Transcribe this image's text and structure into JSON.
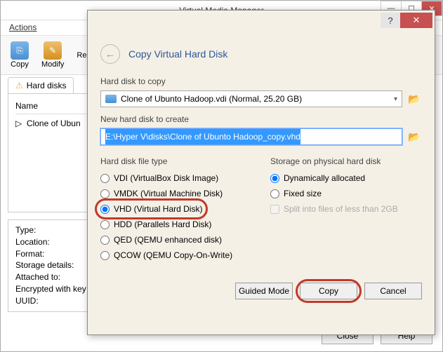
{
  "parent": {
    "title": "Virtual Media Manager",
    "menu": {
      "actions": "Actions"
    },
    "toolbar": {
      "copy": "Copy",
      "modify": "Modify",
      "remove": "Rem"
    },
    "tab": {
      "harddisks": "Hard disks"
    },
    "list": {
      "header": "Name",
      "item": "Clone of Ubun"
    },
    "details": {
      "type": "Type:",
      "location": "Location:",
      "format": "Format:",
      "storage": "Storage details:",
      "attached": "Attached to:",
      "encrypted": "Encrypted with key",
      "uuid": "UUID:"
    },
    "buttons": {
      "close": "Close",
      "help": "Help"
    }
  },
  "wizard": {
    "title": "Copy Virtual Hard Disk",
    "section_copy": "Hard disk to copy",
    "dropdown_value": "Clone of Ubunto Hadoop.vdi (Normal, 25.20 GB)",
    "section_new": "New hard disk to create",
    "path_value": "E:\\Hyper V\\disks\\Clone of Ubunto Hadoop_copy.vhd",
    "section_filetype": "Hard disk file type",
    "section_storage": "Storage on physical hard disk",
    "filetypes": {
      "vdi": "VDI (VirtualBox Disk Image)",
      "vmdk": "VMDK (Virtual Machine Disk)",
      "vhd": "VHD (Virtual Hard Disk)",
      "hdd": "HDD (Parallels Hard Disk)",
      "qed": "QED (QEMU enhanced disk)",
      "qcow": "QCOW (QEMU Copy-On-Write)"
    },
    "storage": {
      "dynamic": "Dynamically allocated",
      "fixed": "Fixed size",
      "split": "Split into files of less than 2GB"
    },
    "buttons": {
      "guided": "Guided Mode",
      "copy": "Copy",
      "cancel": "Cancel"
    }
  }
}
